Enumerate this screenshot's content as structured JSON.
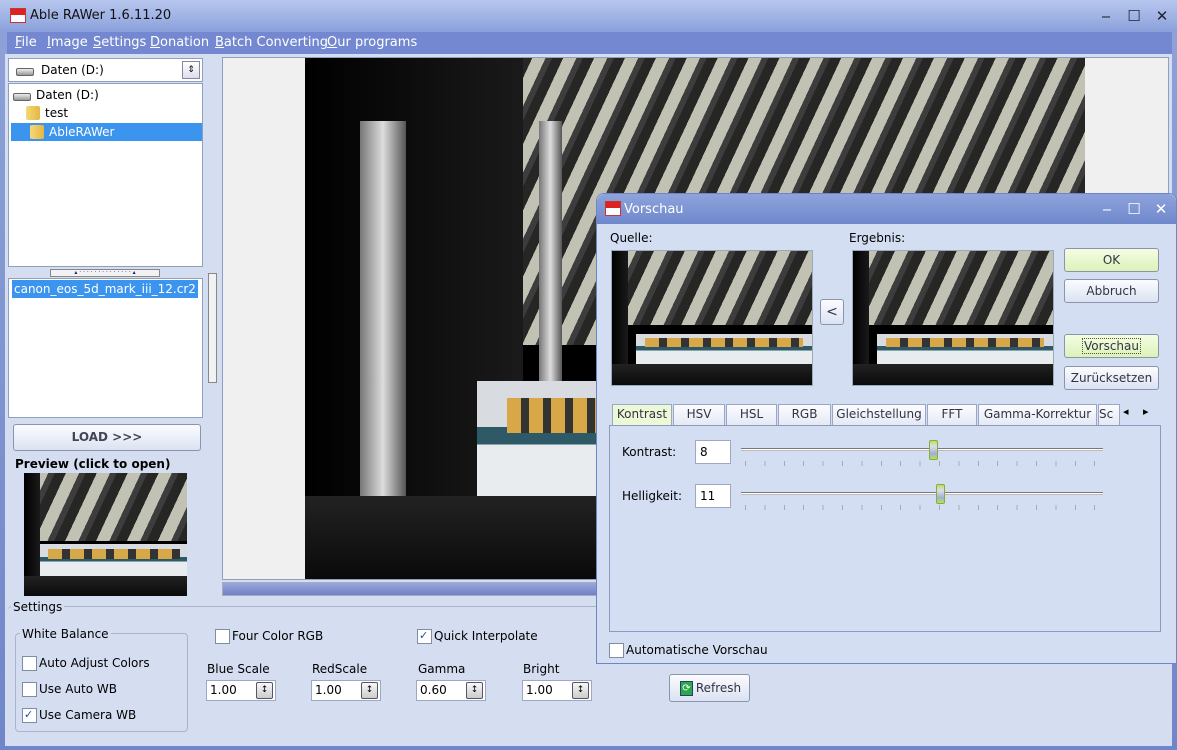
{
  "window": {
    "title": "Able RAWer 1.6.11.20",
    "controls": {
      "minimize": "‒",
      "maximize": "☐",
      "close": "✕"
    }
  },
  "menu": [
    "File",
    "Image",
    "Settings",
    "Donation",
    "Batch Converting",
    "Our programs"
  ],
  "sidebar": {
    "drive_combo": "Daten (D:)",
    "tree": [
      {
        "label": "Daten (D:)",
        "icon": "drive-icon"
      },
      {
        "label": "test",
        "icon": "folder-icon"
      },
      {
        "label": "AbleRAWer",
        "icon": "folder-icon",
        "selected": true
      }
    ],
    "files": [
      {
        "label": "canon_eos_5d_mark_iii_12.cr2",
        "selected": true
      }
    ],
    "load_button": "LOAD >>>",
    "preview_label": "Preview (click to open)"
  },
  "settings": {
    "group_label": "Settings",
    "white_balance": {
      "label": "White Balance",
      "options": [
        {
          "label": "Auto Adjust Colors",
          "checked": false
        },
        {
          "label": "Use Auto WB",
          "checked": false
        },
        {
          "label": "Use Camera WB",
          "checked": true
        }
      ]
    },
    "four_color_rgb": {
      "label": "Four Color RGB",
      "checked": false
    },
    "quick_interpolate": {
      "label": "Quick Interpolate",
      "checked": true
    },
    "fields": [
      {
        "label": "Blue Scale",
        "value": "1.00"
      },
      {
        "label": "RedScale",
        "value": "1.00"
      },
      {
        "label": "Gamma",
        "value": "0.60"
      },
      {
        "label": "Bright",
        "value": "1.00"
      }
    ],
    "refresh_button": "Refresh"
  },
  "dialog": {
    "title": "Vorschau",
    "source_label": "Quelle:",
    "result_label": "Ergebnis:",
    "copy_button": "<",
    "buttons": {
      "ok": "OK",
      "cancel": "Abbruch",
      "preview": "Vorschau",
      "reset": "Zurücksetzen"
    },
    "tabs": [
      "Kontrast",
      "HSV",
      "HSL",
      "RGB",
      "Gleichstellung",
      "FFT",
      "Gamma-Korrektur",
      "Sc"
    ],
    "active_tab": "Kontrast",
    "tab_scroll": {
      "left": "◂",
      "right": "▸"
    },
    "sliders": [
      {
        "label": "Kontrast:",
        "value": "8",
        "fraction": 0.53
      },
      {
        "label": "Helligkeit:",
        "value": "11",
        "fraction": 0.55
      }
    ],
    "auto_preview": {
      "label": "Automatische Vorschau",
      "checked": false
    }
  }
}
